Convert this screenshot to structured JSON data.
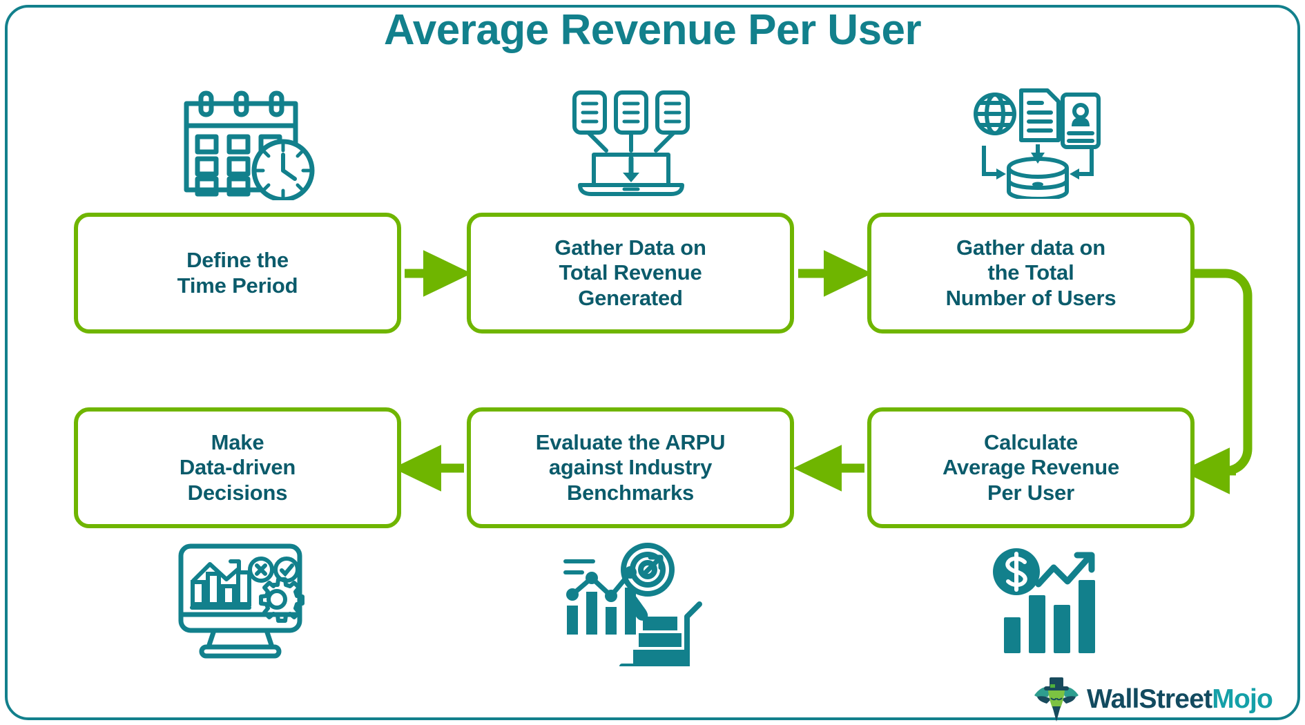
{
  "header": {
    "title": "Average Revenue Per User"
  },
  "colors": {
    "frame_border": "#12808C",
    "title_text": "#12808C",
    "box_border": "#6FB500",
    "box_text": "#0B5B6B",
    "arrow": "#6FB500",
    "icon": "#12808C",
    "logo_primary": "#124A5F",
    "logo_accent": "#15A0A8",
    "background": "#FFFFFF"
  },
  "flow": {
    "steps": [
      {
        "id": 1,
        "label": "Define the\nTime Period",
        "icon": "calendar-clock-icon"
      },
      {
        "id": 2,
        "label": "Gather Data on\nTotal Revenue\nGenerated",
        "icon": "documents-to-laptop-icon"
      },
      {
        "id": 3,
        "label": "Gather data on\nthe Total\nNumber of Users",
        "icon": "data-sources-database-icon"
      },
      {
        "id": 4,
        "label": "Calculate\nAverage Revenue\nPer User",
        "icon": "dollar-growth-chart-icon"
      },
      {
        "id": 5,
        "label": "Evaluate the ARPU\nagainst Industry\nBenchmarks",
        "icon": "analytics-target-cart-icon"
      },
      {
        "id": 6,
        "label": "Make\nData-driven\nDecisions",
        "icon": "monitor-dashboard-gear-icon"
      }
    ],
    "connectors": [
      {
        "from": 1,
        "to": 2,
        "direction": "right"
      },
      {
        "from": 2,
        "to": 3,
        "direction": "right"
      },
      {
        "from": 3,
        "to": 4,
        "direction": "loop-right-down-left"
      },
      {
        "from": 4,
        "to": 5,
        "direction": "left"
      },
      {
        "from": 5,
        "to": 6,
        "direction": "left"
      }
    ]
  },
  "branding": {
    "name_primary": "WallStreet",
    "name_accent": "Mojo",
    "mark": "crocodile-tophat-logo-icon"
  }
}
